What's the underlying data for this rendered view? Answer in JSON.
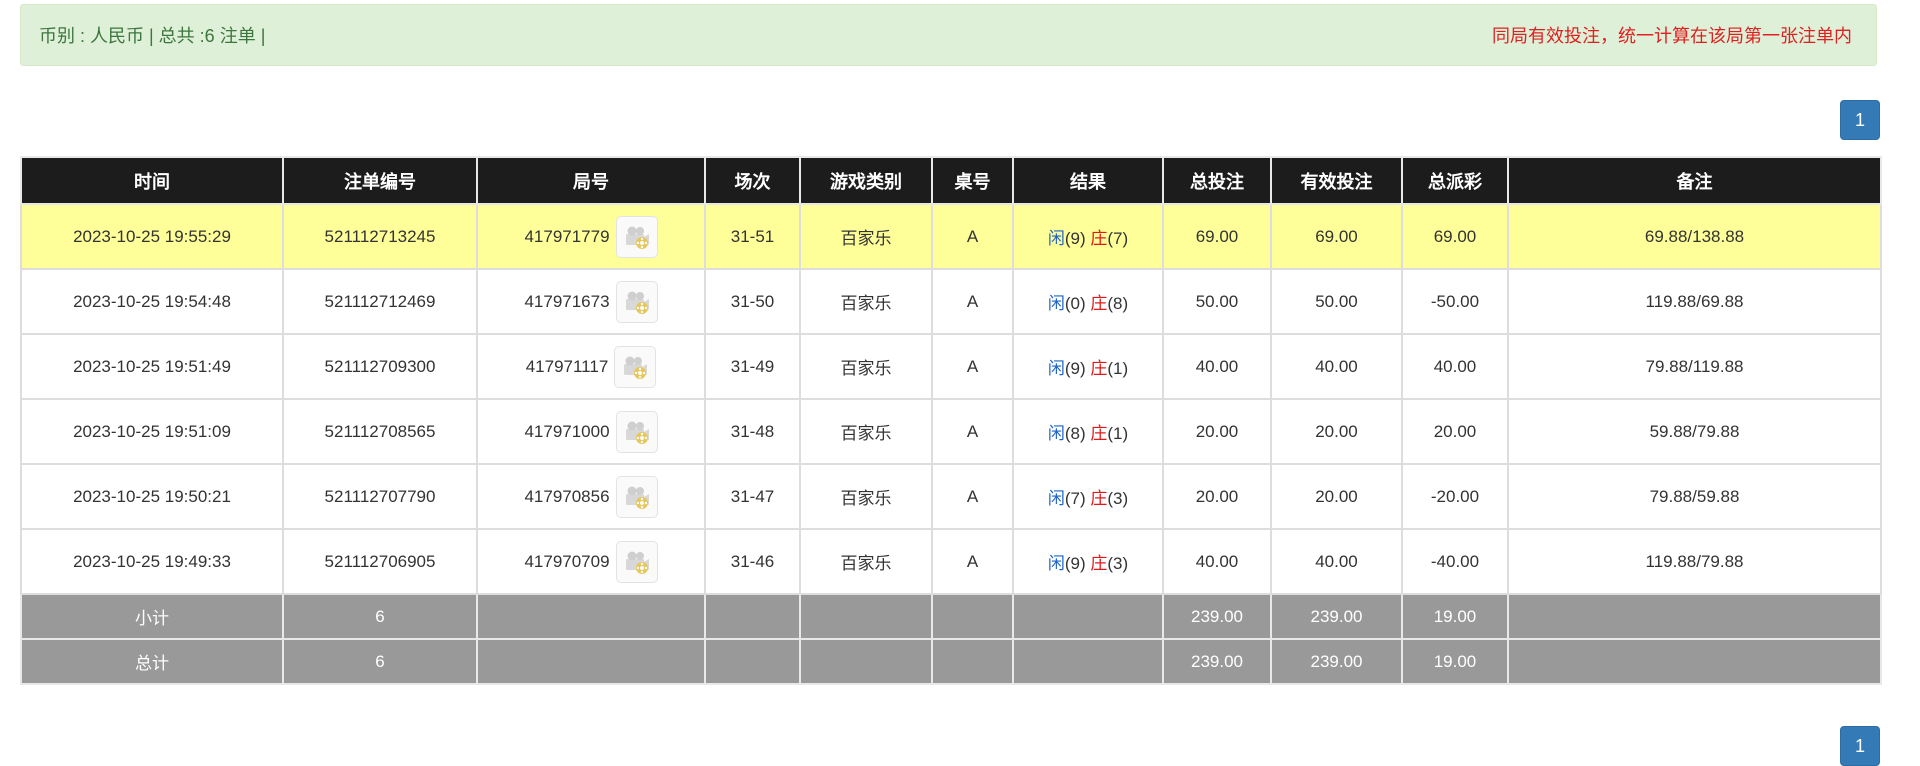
{
  "info": {
    "left": "币别 : 人民币 | 总共 :6 注单 |",
    "right": "同局有效投注，统一计算在该局第一张注单内"
  },
  "pagination": {
    "page": "1"
  },
  "headers": [
    "时间",
    "注单编号",
    "局号",
    "场次",
    "游戏类别",
    "桌号",
    "结果",
    "总投注",
    "有效投注",
    "总派彩",
    "备注"
  ],
  "result_labels": {
    "player": "闲",
    "banker": "庄"
  },
  "rows": [
    {
      "time": "2023-10-25 19:55:29",
      "bet_no": "521112713245",
      "round_no": "417971779",
      "session": "31-51",
      "game": "百家乐",
      "table": "A",
      "player_score": "(9)",
      "banker_score": "(7)",
      "total_bet": "69.00",
      "valid_bet": "69.00",
      "payout": "69.00",
      "payout_negative": false,
      "note": "69.88/138.88"
    },
    {
      "time": "2023-10-25 19:54:48",
      "bet_no": "521112712469",
      "round_no": "417971673",
      "session": "31-50",
      "game": "百家乐",
      "table": "A",
      "player_score": "(0)",
      "banker_score": "(8)",
      "total_bet": "50.00",
      "valid_bet": "50.00",
      "payout": "-50.00",
      "payout_negative": true,
      "note": "119.88/69.88"
    },
    {
      "time": "2023-10-25 19:51:49",
      "bet_no": "521112709300",
      "round_no": "417971117",
      "session": "31-49",
      "game": "百家乐",
      "table": "A",
      "player_score": "(9)",
      "banker_score": "(1)",
      "total_bet": "40.00",
      "valid_bet": "40.00",
      "payout": "40.00",
      "payout_negative": false,
      "note": "79.88/119.88"
    },
    {
      "time": "2023-10-25 19:51:09",
      "bet_no": "521112708565",
      "round_no": "417971000",
      "session": "31-48",
      "game": "百家乐",
      "table": "A",
      "player_score": "(8)",
      "banker_score": "(1)",
      "total_bet": "20.00",
      "valid_bet": "20.00",
      "payout": "20.00",
      "payout_negative": false,
      "note": "59.88/79.88"
    },
    {
      "time": "2023-10-25 19:50:21",
      "bet_no": "521112707790",
      "round_no": "417970856",
      "session": "31-47",
      "game": "百家乐",
      "table": "A",
      "player_score": "(7)",
      "banker_score": "(3)",
      "total_bet": "20.00",
      "valid_bet": "20.00",
      "payout": "-20.00",
      "payout_negative": true,
      "note": "79.88/59.88"
    },
    {
      "time": "2023-10-25 19:49:33",
      "bet_no": "521112706905",
      "round_no": "417970709",
      "session": "31-46",
      "game": "百家乐",
      "table": "A",
      "player_score": "(9)",
      "banker_score": "(3)",
      "total_bet": "40.00",
      "valid_bet": "40.00",
      "payout": "-40.00",
      "payout_negative": true,
      "note": "119.88/79.88"
    }
  ],
  "subtotal": {
    "label": "小计",
    "count": "6",
    "total_bet": "239.00",
    "valid_bet": "239.00",
    "payout": "19.00"
  },
  "grand_total": {
    "label": "总计",
    "count": "6",
    "total_bet": "239.00",
    "valid_bet": "239.00",
    "payout": "19.00"
  },
  "colors": {
    "header_bg": "#1c1c1c",
    "highlight_row": "#ffff99",
    "total_row": "#999999",
    "blue": "#1e63c8",
    "red": "#e01818",
    "info_bg": "#dff0d8"
  },
  "icons": {
    "replay": "film-reel-icon"
  }
}
